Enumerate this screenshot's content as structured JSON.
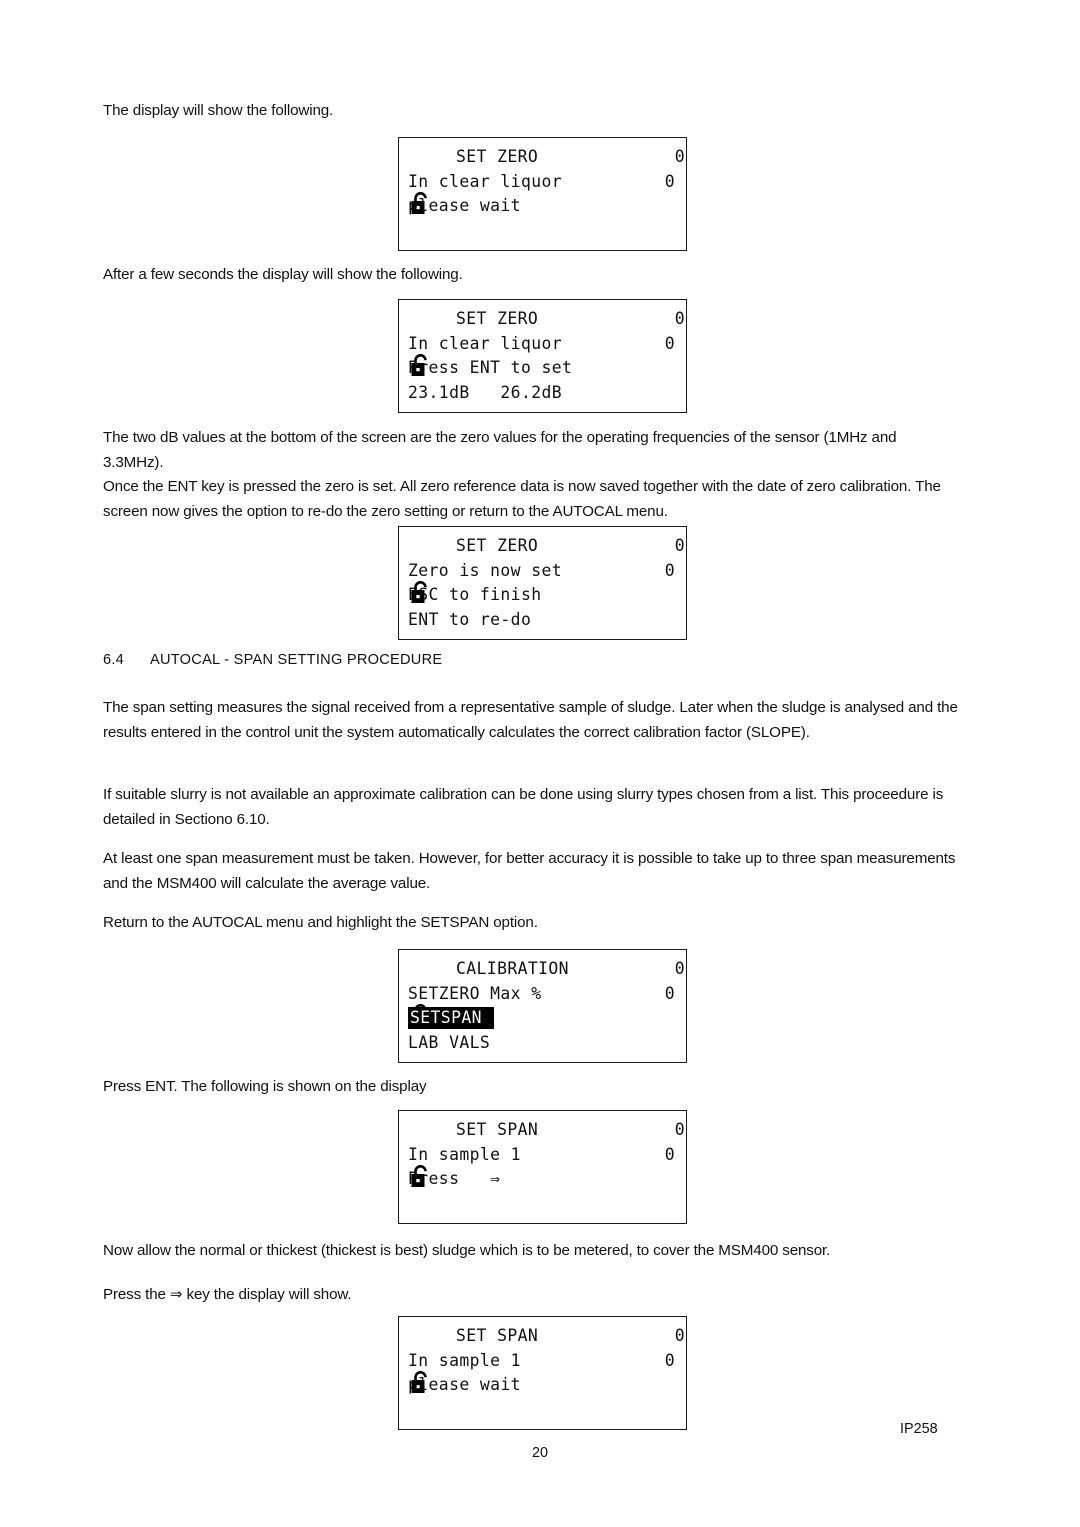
{
  "document": {
    "page_number": "20",
    "doc_code": "IP258"
  },
  "intro": {
    "line1": "The display will show the following.",
    "line2": "After a few seconds the display will show the following."
  },
  "paragraphs": {
    "db_values": "The two dB values at the bottom of the screen are the zero values for the operating frequencies of the sensor (1MHz and 3.3MHz).\nOnce the ENT key is pressed the zero is set. All zero reference data is now saved together with the date of zero calibration. The screen now gives the option to re-do the zero setting or return to the AUTOCAL menu.",
    "span_intro": "The span setting measures the signal received from a representative sample of sludge. Later when the sludge is analysed and the results entered in the control unit the system automatically calculates the correct calibration factor (SLOPE).",
    "slurry": "If suitable slurry is not available an approximate calibration can be done using slurry types chosen from a list.  This proceedure is detailed in Sectiono 6.10.",
    "measurements": "At least one span measurement must be taken. However, for better accuracy it is possible to take up to three span measurements and the MSM400 will calculate the average value.",
    "return_autocal": "Return to the AUTOCAL menu and highlight the SETSPAN option.",
    "press_ent": "Press ENT. The following is shown on the display",
    "now_allow": "Now allow the normal or thickest (thickest is best) sludge which is to be metered, to cover the MSM400 sensor.",
    "press_key": "Press the ⇒ key the display will show."
  },
  "heading": {
    "number": "6.4",
    "text": "AUTOCAL - SPAN SETTING PROCEDURE"
  },
  "displays": {
    "set_zero_wait": {
      "icon": "open-padlock-icon",
      "title": "SET ZERO",
      "title_right": "0",
      "line2": "In clear liquor",
      "line2_right": "0",
      "line3": "please wait",
      "line4": ""
    },
    "set_zero_press_ent": {
      "icon": "open-padlock-icon",
      "title": "SET ZERO",
      "title_right": "0",
      "line2": "In clear liquor",
      "line2_right": "0",
      "line3": "Press ENT to set",
      "line4": "23.1dB   26.2dB"
    },
    "zero_now_set": {
      "icon": "open-padlock-icon",
      "title": "SET ZERO",
      "title_right": "0",
      "line2": "Zero is now set",
      "line2_right": "0",
      "line3": "ESC to finish",
      "line4": "ENT to re-do"
    },
    "calibration_menu": {
      "icon": "open-padlock-icon",
      "title": "CALIBRATION",
      "title_right": "0",
      "line2": "SETZERO Max %",
      "line2_right": "0",
      "line3_highlighted": "SETSPAN",
      "line4": "LAB VALS"
    },
    "set_span_press": {
      "icon": "open-padlock-icon",
      "title": "SET SPAN",
      "title_right": "0",
      "line2": "In sample 1",
      "line2_right": "0",
      "line3": "Press   ⇒",
      "line4": ""
    },
    "set_span_wait": {
      "icon": "open-padlock-icon",
      "title": "SET SPAN",
      "title_right": "0",
      "line2": "In sample 1",
      "line2_right": "0",
      "line3": "please wait",
      "line4": ""
    }
  }
}
